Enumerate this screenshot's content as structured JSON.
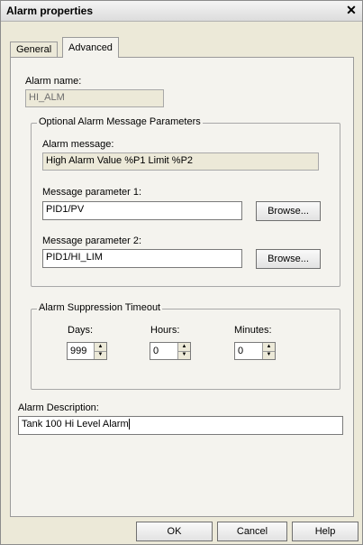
{
  "window": {
    "title": "Alarm properties"
  },
  "tabs": [
    {
      "label": "General",
      "active": false
    },
    {
      "label": "Advanced",
      "active": true
    }
  ],
  "alarm_name": {
    "label": "Alarm name:",
    "value": "HI_ALM"
  },
  "message_group": {
    "title": "Optional Alarm Message Parameters",
    "message_label": "Alarm message:",
    "message_value": "High Alarm Value %P1 Limit %P2",
    "param1_label": "Message parameter 1:",
    "param1_value": "PID1/PV",
    "param2_label": "Message parameter 2:",
    "param2_value": "PID1/HI_LIM",
    "browse_label": "Browse..."
  },
  "suppression_group": {
    "title": "Alarm Suppression Timeout",
    "days_label": "Days:",
    "days_value": "999",
    "hours_label": "Hours:",
    "hours_value": "0",
    "minutes_label": "Minutes:",
    "minutes_value": "0"
  },
  "description": {
    "label": "Alarm Description:",
    "value": "Tank 100 Hi Level Alarm"
  },
  "buttons": {
    "ok": "OK",
    "cancel": "Cancel",
    "help": "Help"
  },
  "icons": {
    "close": "close-icon",
    "spin_up": "spin-up-icon",
    "spin_down": "spin-down-icon"
  }
}
